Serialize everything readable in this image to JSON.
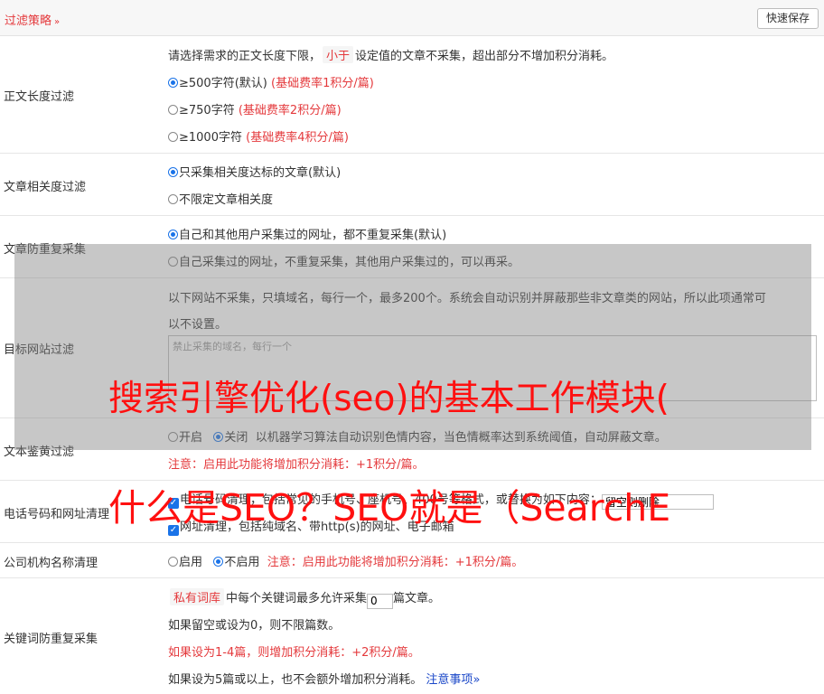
{
  "header": {
    "title": "过滤策略",
    "chevron": "»",
    "save_label": "快速保存"
  },
  "length": {
    "label": "正文长度过滤",
    "desc_pre": "请选择需求的正文长度下限，",
    "desc_tag": "小于",
    "desc_post": "设定值的文章不采集，超出部分不增加积分消耗。",
    "options": [
      {
        "text": "≥500字符(默认)",
        "note": "(基础费率1积分/篇)"
      },
      {
        "text": "≥750字符",
        "note": "(基础费率2积分/篇)"
      },
      {
        "text": "≥1000字符",
        "note": "(基础费率4积分/篇)"
      }
    ]
  },
  "relevance": {
    "label": "文章相关度过滤",
    "options": [
      "只采集相关度达标的文章(默认)",
      "不限定文章相关度"
    ]
  },
  "duplicate": {
    "label": "文章防重复采集",
    "options": [
      "自己和其他用户采集过的网址，都不重复采集(默认)",
      "自己采集过的网址，不重复采集，其他用户采集过的，可以再采。"
    ]
  },
  "site_filter": {
    "label": "目标网站过滤",
    "desc_line1": "以下网站不采集，只填域名，每行一个，最多200个。系统会自动识别并屏蔽那些非文章类的网站，所以此项通常可",
    "desc_line2": "以不设置。",
    "placeholder": "禁止采集的域名，每行一个"
  },
  "porn": {
    "label": "文本鉴黄过滤",
    "opt_on": "开启",
    "opt_off": "关闭",
    "desc": "以机器学习算法自动识别色情内容，当色情概率达到系统阈值，自动屏蔽文章。",
    "note": "注意：启用此功能将增加积分消耗：+1积分/篇。"
  },
  "phone": {
    "label": "电话号码和网址清理",
    "line1": "电话号码清理，包括常见的手机号、座机号、400号等格式，或替换为如下内容：",
    "input_value": "留空则删除",
    "line2": "网址清理，包括纯域名、带http(s)的网址、电子邮箱"
  },
  "company": {
    "label": "公司机构名称清理",
    "opt_on": "启用",
    "opt_off": "不启用",
    "note": "注意：启用此功能将增加积分消耗：+1积分/篇。"
  },
  "keyword": {
    "label": "关键词防重复采集",
    "tag": "私有词库",
    "line1_pre": "中每个关键词最多允许采集",
    "line1_value": "0",
    "line1_post": "篇文章。",
    "line2": "如果留空或设为0，则不限篇数。",
    "line3": "如果设为1-4篇，则增加积分消耗：+2积分/篇。",
    "line4": "如果设为5篇或以上，也不会额外增加积分消耗。",
    "link": "注意事项",
    "link_chev": "»"
  },
  "overlay": {
    "title1": "搜索引擎优化(seo)的基本工作模块(",
    "title2": "什么是SEO？SEO就是（SearchE"
  },
  "colors": {
    "accent": "#e4393c",
    "radio": "#1a73e8",
    "link": "#1a47c8",
    "overlay_text": "#ff1010"
  }
}
